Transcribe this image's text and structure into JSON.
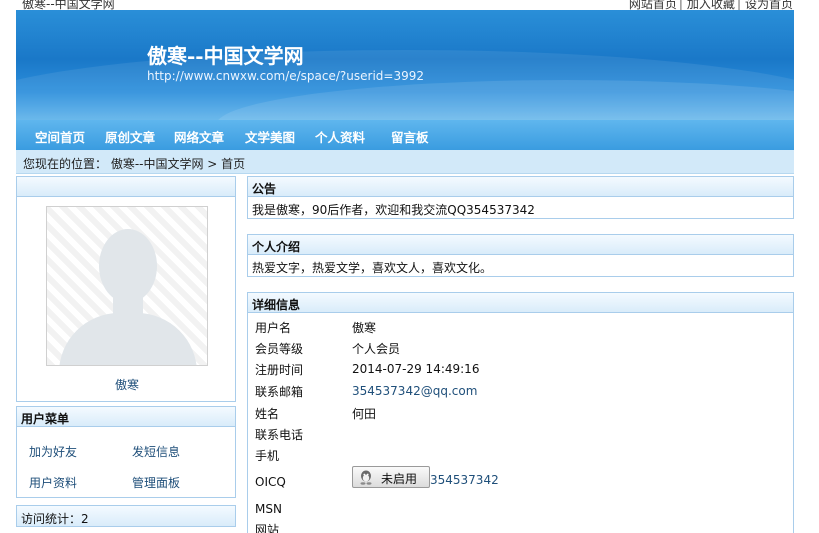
{
  "topbar": {
    "site_name": "傲寒--中国文学网",
    "links": [
      "网站首页",
      "加入收藏",
      "设为首页"
    ],
    "sep": "|"
  },
  "banner": {
    "title": "傲寒--中国文学网",
    "url": "http://www.cnwxw.com/e/space/?userid=3992"
  },
  "nav": {
    "items": [
      "空间首页",
      "原创文章",
      "网络文章",
      "文学美图",
      "个人资料",
      "留言板"
    ]
  },
  "breadcrumb": {
    "text": "您现在的位置： 傲寒--中国文学网 > 首页"
  },
  "sidebar": {
    "profile_name": "傲寒",
    "menu_title": "用户菜单",
    "menu_items": [
      "加为好友",
      "发短信息",
      "用户资料",
      "管理面板"
    ],
    "visits": "访问统计：2"
  },
  "notice": {
    "title": "公告",
    "text": "我是傲寒，90后作者，欢迎和我交流QQ354537342"
  },
  "intro": {
    "title": "个人介绍",
    "text": "热爱文字，热爱文学，喜欢文人，喜欢文化。"
  },
  "details": {
    "title": "详细信息",
    "rows": [
      {
        "label": "用户名",
        "value": "傲寒"
      },
      {
        "label": "会员等级",
        "value": "个人会员"
      },
      {
        "label": "注册时间",
        "value": "2014-07-29 14:49:16"
      },
      {
        "label": "联系邮箱",
        "value": "354537342@qq.com"
      },
      {
        "label": "姓名",
        "value": "何田"
      },
      {
        "label": "联系电话",
        "value": ""
      },
      {
        "label": "手机",
        "value": ""
      },
      {
        "label": "OICQ",
        "value": "354537342"
      },
      {
        "label": "MSN",
        "value": ""
      },
      {
        "label": "网站",
        "value": ""
      }
    ],
    "qq_status": "未启用"
  }
}
